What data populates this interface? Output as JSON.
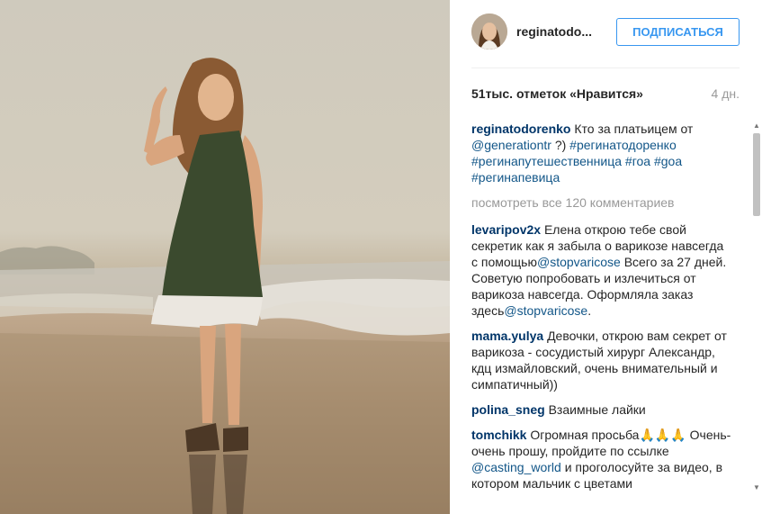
{
  "post": {
    "username": "reginatodo...",
    "follow_label": "ПОДПИСАТЬСЯ",
    "likes": "51тыс. отметок «Нравится»",
    "time_ago": "4 дн."
  },
  "caption": {
    "user": "reginatodorenko",
    "text": "Кто за платьицем от",
    "mention": "@generationtr",
    "after_mention": "?)",
    "tags": [
      "#регинатодоренко",
      "#регинапутешественница",
      "#гоа",
      "#goa",
      "#регинапевица"
    ]
  },
  "view_all_label": "посмотреть все 120 комментариев",
  "comments": [
    {
      "user": "levaripov2x",
      "text_1": "Елена открою тебе свой секретик как я забыла о варикозе навсегда с помощью",
      "mention_1": "@stopvaricose",
      "text_2": "Всего за 27 дней. Советую попробовать и излечиться от варикоза навсегда. Оформляла заказ здесь",
      "mention_2": "@stopvaricose",
      "text_3": "."
    },
    {
      "user": "mama.yulya",
      "text": "Девочки, открою вам секрет от варикоза - сосудистый хирург Александр, кдц измайловский, очень внимательный и симпатичный))"
    },
    {
      "user": "polina_sneg",
      "text": "Взаимные лайки"
    },
    {
      "user": "tomchikk",
      "text_1": "Огромная просьба🙏🙏🙏 Очень-очень прошу, пройдите по ссылке",
      "mention": "@casting_world",
      "text_2": "и проголосуйте за видео, в котором мальчик с цветами"
    }
  ],
  "colors": {
    "accent": "#3897f0",
    "username": "#003569",
    "link": "#125688",
    "muted": "#999999"
  },
  "icons": {
    "scroll_up": "triangle-up-icon",
    "scroll_down": "triangle-down-icon"
  }
}
